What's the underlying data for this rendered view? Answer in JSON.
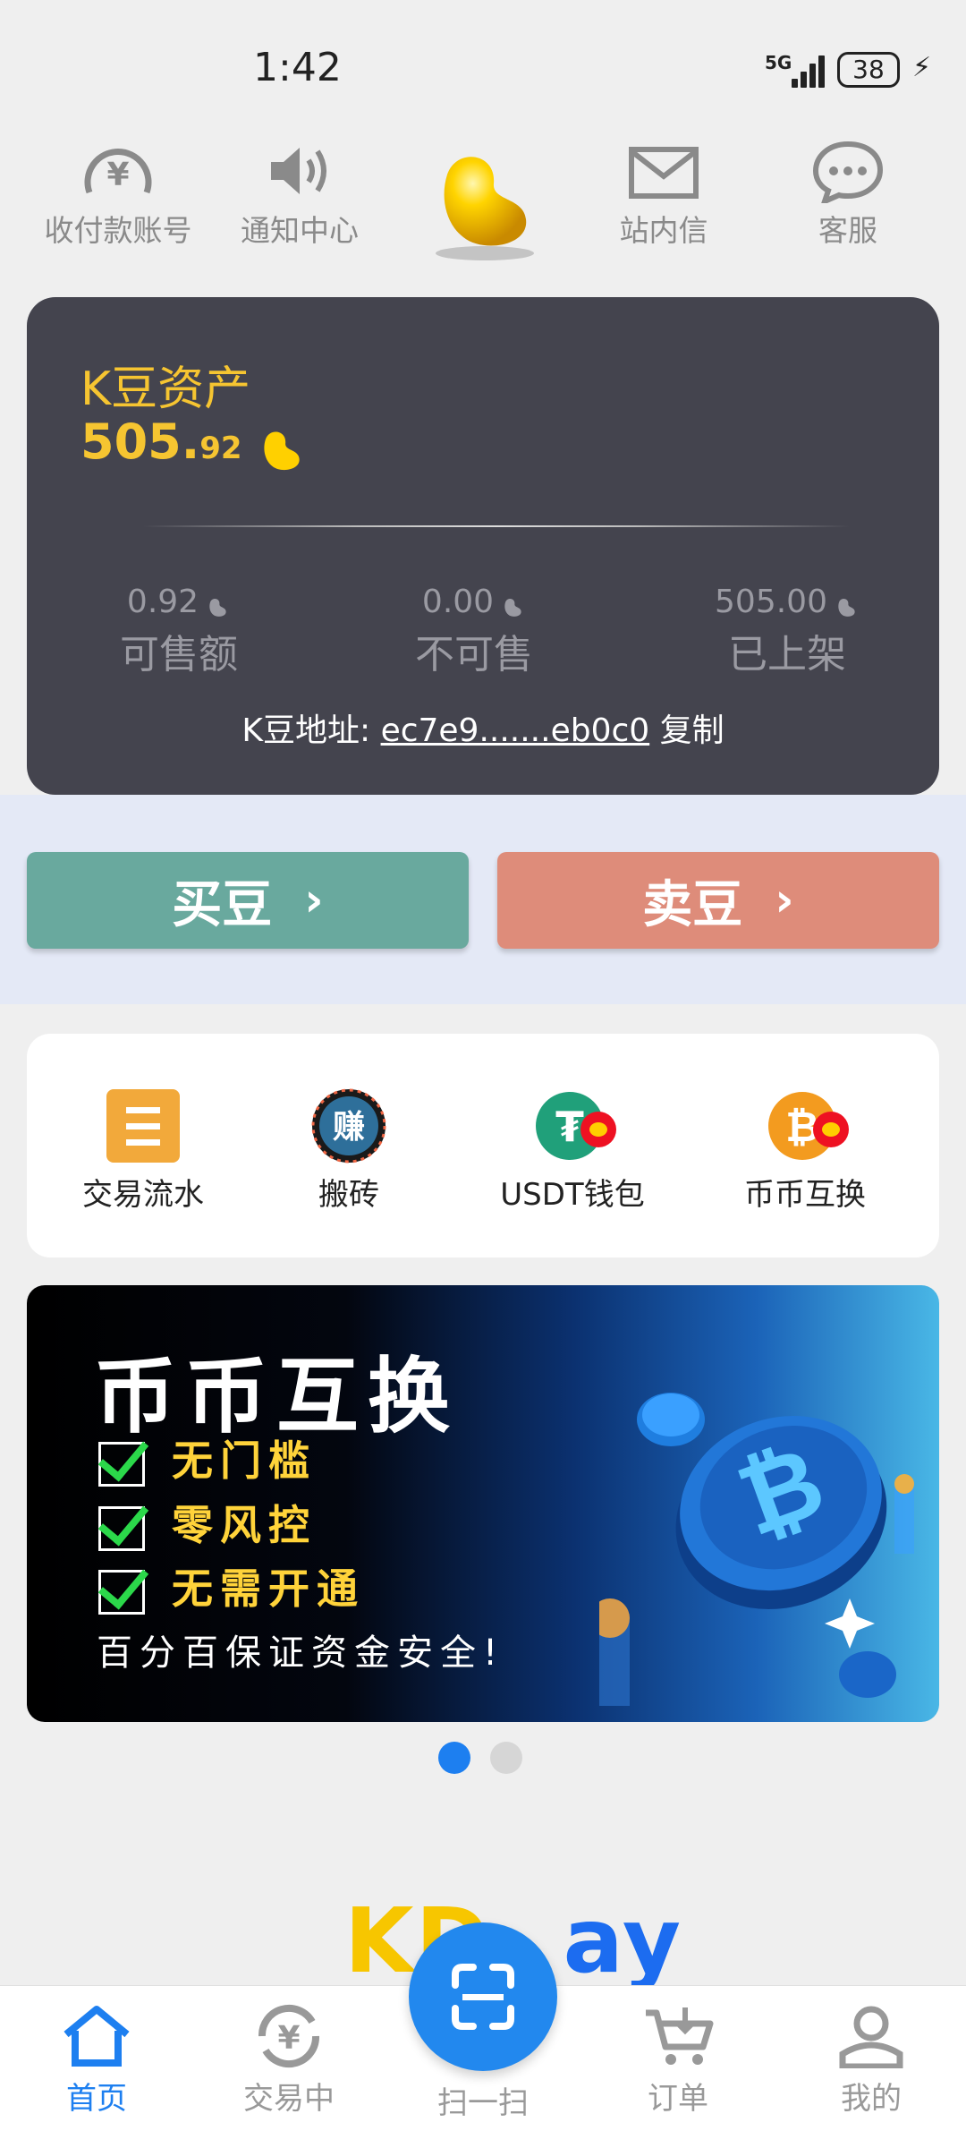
{
  "status_bar": {
    "time": "1:42",
    "network": "5G",
    "battery": "38"
  },
  "top_nav": [
    {
      "label": "收付款账号",
      "icon": "yen-circle-icon"
    },
    {
      "label": "通知中心",
      "icon": "speaker-icon"
    },
    {
      "label": "",
      "icon": "golden-bean-logo"
    },
    {
      "label": "站内信",
      "icon": "envelope-icon"
    },
    {
      "label": "客服",
      "icon": "chat-bubble-icon"
    }
  ],
  "asset": {
    "title": "K豆资产",
    "amount_int": "505.",
    "amount_dec": "92",
    "stats": [
      {
        "value": "0.92",
        "label": "可售额"
      },
      {
        "value": "0.00",
        "label": "不可售"
      },
      {
        "value": "505.00",
        "label": "已上架"
      }
    ],
    "address_label": "K豆地址:",
    "address_value": "ec7e9.......eb0c0",
    "copy_label": "复制"
  },
  "actions": {
    "buy_label": "买豆",
    "sell_label": "卖豆",
    "chevron": "›"
  },
  "functions": [
    {
      "label": "交易流水",
      "icon": "list-icon"
    },
    {
      "label": "搬砖",
      "icon": "earn-icon",
      "icon_text": "赚"
    },
    {
      "label": "USDT钱包",
      "icon": "usdt-icon",
      "icon_text": "₮"
    },
    {
      "label": "币币互换",
      "icon": "bitcoin-swap-icon",
      "icon_text": "₿"
    }
  ],
  "banner": {
    "heading": "币币互换",
    "items": [
      "无门槛",
      "零风控",
      "无需开通"
    ],
    "footer": "百分百保证资金安全!"
  },
  "carousel": {
    "count": 2,
    "active": 0,
    "active_color": "#1d7ff0",
    "inactive_color": "#d6d6d6"
  },
  "logo": {
    "k": "KD",
    "p": "ay"
  },
  "tabs": [
    {
      "label": "首页",
      "icon": "home-icon",
      "active": true
    },
    {
      "label": "交易中",
      "icon": "yen-cycle-icon",
      "active": false
    },
    {
      "label": "扫一扫",
      "icon": "scan-icon",
      "active": false
    },
    {
      "label": "订单",
      "icon": "cart-icon",
      "active": false
    },
    {
      "label": "我的",
      "icon": "user-icon",
      "active": false
    }
  ],
  "colors": {
    "accent": "#1d7ff0",
    "gold": "#f6c531",
    "buy": "#69a99e",
    "sell": "#de8c7a",
    "card": "#44444e"
  }
}
